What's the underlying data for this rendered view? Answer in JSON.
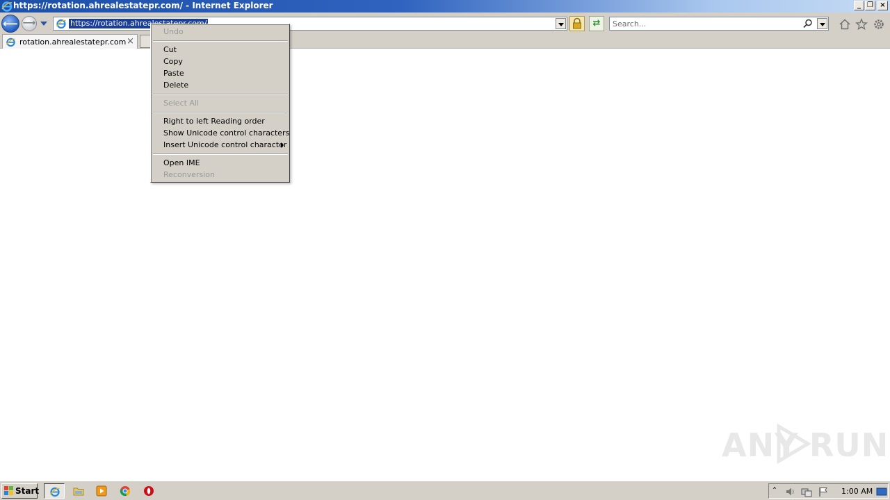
{
  "window": {
    "title": "https://rotation.ahrealestatepr.com/ - Internet Explorer",
    "controls": {
      "minimize": "_",
      "restore": "❐",
      "close": "×"
    }
  },
  "navbar": {
    "address_value": "https://rotation.ahrealestatepr.com/",
    "search_placeholder": "Search..."
  },
  "tabs": [
    {
      "label": "rotation.ahrealestatepr.com",
      "close": "×"
    }
  ],
  "context_menu": {
    "items": [
      {
        "label": "Undo",
        "disabled": true
      },
      {
        "label": "Cut",
        "disabled": false
      },
      {
        "label": "Copy",
        "disabled": false
      },
      {
        "label": "Paste",
        "disabled": false
      },
      {
        "label": "Delete",
        "disabled": false
      },
      {
        "label": "Select All",
        "disabled": true
      },
      {
        "label": "Right to left Reading order",
        "disabled": false
      },
      {
        "label": "Show Unicode control characters",
        "disabled": false
      },
      {
        "label": "Insert Unicode control character",
        "disabled": false,
        "submenu": true
      },
      {
        "label": "Open IME",
        "disabled": false
      },
      {
        "label": "Reconversion",
        "disabled": true
      }
    ]
  },
  "watermark": {
    "text": "ANY",
    "text2": "RUN"
  },
  "taskbar": {
    "start_label": "Start",
    "apps": [
      "internet-explorer",
      "file-explorer",
      "media-player",
      "chrome",
      "opera"
    ],
    "clock": "1:00 AM"
  },
  "colors": {
    "selection": "#1b3e9a",
    "chrome_bg": "#d4d0c8",
    "titlebar_start": "#1c4fa8"
  }
}
